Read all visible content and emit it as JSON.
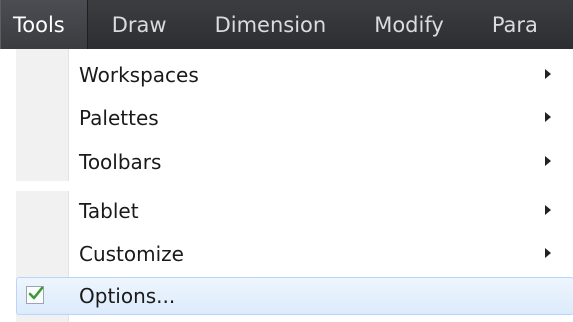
{
  "menubar": {
    "items": [
      {
        "label": "Tools"
      },
      {
        "label": "Draw"
      },
      {
        "label": "Dimension"
      },
      {
        "label": "Modify"
      },
      {
        "label": "Para"
      }
    ],
    "active_index": 0
  },
  "dropdown": {
    "items": [
      {
        "label": "Workspaces",
        "submenu": true
      },
      {
        "label": "Palettes",
        "submenu": true
      },
      {
        "label": "Toolbars",
        "submenu": true
      },
      {
        "label": "Tablet",
        "submenu": true
      },
      {
        "label": "Customize",
        "submenu": true
      },
      {
        "label": "Options...",
        "submenu": false,
        "checked": true,
        "highlighted": true
      }
    ]
  },
  "colors": {
    "menubar_bg": "#2c2e31",
    "menubar_text": "#d8dbe0",
    "highlight_bg": "#dcebfc",
    "highlight_border": "#b8d6fb",
    "check": "#3d9b2f"
  },
  "icons": {
    "submenu": "chevron-right-icon",
    "checked": "checkmark-icon"
  }
}
